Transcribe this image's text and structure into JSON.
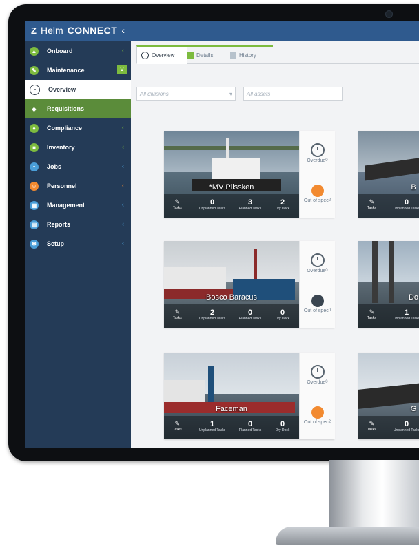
{
  "app": {
    "logo_mark": "Z",
    "logo_thin": "Helm",
    "logo_bold": "CONNECT",
    "logo_chevron": "‹"
  },
  "sidebar": {
    "items": [
      {
        "label": "Onboard",
        "icon": "ship-icon"
      },
      {
        "label": "Maintenance",
        "icon": "wrench-icon",
        "expanded_marker": "˅"
      },
      {
        "label": "Overview",
        "icon": "gauge-icon"
      },
      {
        "label": "Requisitions",
        "icon": "tag-icon"
      },
      {
        "label": "Compliance",
        "icon": "shield-icon"
      },
      {
        "label": "Inventory",
        "icon": "box-icon"
      },
      {
        "label": "Jobs",
        "icon": "helmet-icon"
      },
      {
        "label": "Personnel",
        "icon": "people-icon"
      },
      {
        "label": "Management",
        "icon": "grid-icon"
      },
      {
        "label": "Reports",
        "icon": "report-icon"
      },
      {
        "label": "Setup",
        "icon": "gear-icon"
      }
    ],
    "chevron": "‹",
    "pin": "|←"
  },
  "tabs": [
    {
      "label": "Overview"
    },
    {
      "label": "Details"
    },
    {
      "label": "History"
    }
  ],
  "filters": {
    "divisions_placeholder": "All divisions",
    "assets_placeholder": "All assets",
    "select_arrow": "▾"
  },
  "labels": {
    "tasks": "Tasks",
    "unplanned": "Unplanned Tasks",
    "planned": "Planned Tasks",
    "drydock": "Dry Dock",
    "overdue": "Overdue",
    "out_of_spec": "Out of spec"
  },
  "cards": [
    {
      "name": "*MV Plissken",
      "unplanned": "0",
      "planned": "3",
      "drydock": "2",
      "overdue_count": "0",
      "spec_count": "2",
      "spec_alert": true
    },
    {
      "name": "B",
      "unplanned": "0",
      "planned": "",
      "drydock": "",
      "overdue_count": "",
      "spec_count": "",
      "spec_alert": false
    },
    {
      "name": "Bosco Baracus",
      "unplanned": "2",
      "planned": "0",
      "drydock": "0",
      "overdue_count": "0",
      "spec_count": "0",
      "spec_alert": false
    },
    {
      "name": "Do",
      "unplanned": "1",
      "planned": "",
      "drydock": "",
      "overdue_count": "",
      "spec_count": "",
      "spec_alert": false
    },
    {
      "name": "Faceman",
      "unplanned": "1",
      "planned": "0",
      "drydock": "0",
      "overdue_count": "0",
      "spec_count": "2",
      "spec_alert": true
    },
    {
      "name": "G",
      "unplanned": "0",
      "planned": "",
      "drydock": "",
      "overdue_count": "",
      "spec_count": "",
      "spec_alert": false
    }
  ],
  "colors": {
    "topbar": "#2f5a8e",
    "sidebar": "#243b57",
    "accent_green": "#7dbb3f",
    "alert_orange": "#f28a30"
  }
}
